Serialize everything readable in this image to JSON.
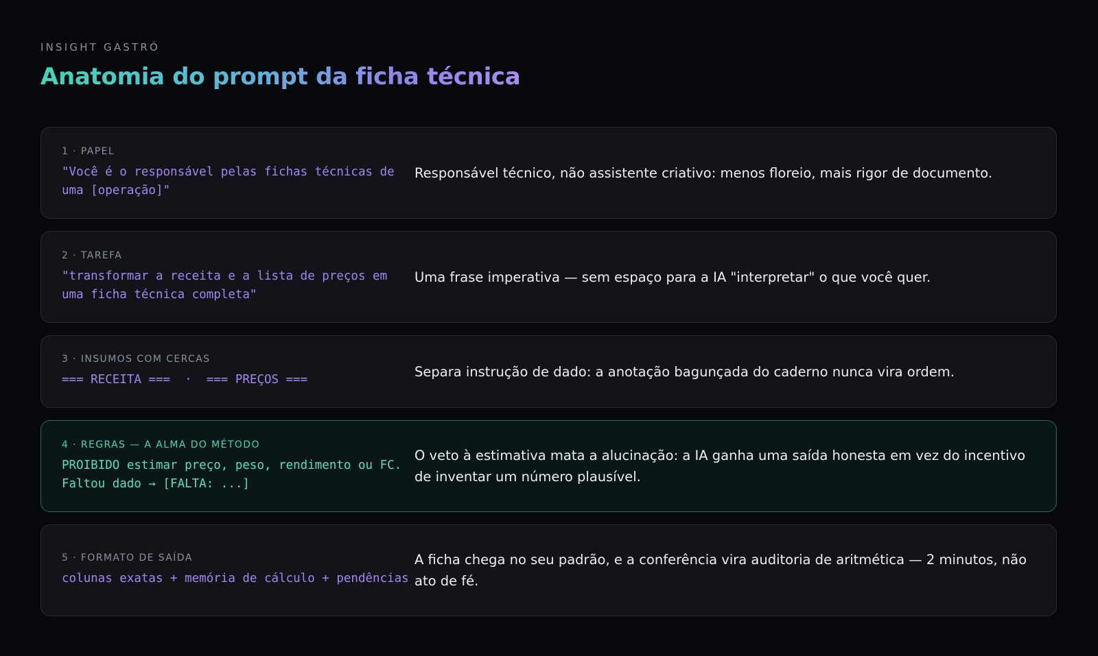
{
  "header": {
    "eyebrow": "INSIGHT GASTRÓ",
    "title": "Anatomia do prompt da ficha técnica"
  },
  "cards": [
    {
      "label": "1 · PAPEL",
      "code": "\"Você é o responsável pelas fichas técnicas de uma [operação]\"",
      "description": "Responsável técnico, não assistente criativo: menos floreio, mais rigor de documento."
    },
    {
      "label": "2 · TAREFA",
      "code": "\"transformar a receita e a lista de preços em uma ficha técnica completa\"",
      "description": "Uma frase imperativa — sem espaço para a IA \"interpretar\" o que você quer."
    },
    {
      "label": "3 · INSUMOS COM CERCAS",
      "code": "=== RECEITA ===  ·  === PREÇOS ===",
      "description": "Separa instrução de dado: a anotação bagunçada do caderno nunca vira ordem."
    },
    {
      "label": "4 · REGRAS — A ALMA DO MÉTODO",
      "code": "PROIBIDO estimar preço, peso, rendimento ou FC. Faltou dado → [FALTA: ...]",
      "description": "O veto à estimativa mata a alucinação: a IA ganha uma saída honesta em vez do incentivo de inventar um número plausível."
    },
    {
      "label": "5 · FORMATO DE SAÍDA",
      "code": "colunas exatas + memória de cálculo + pendências",
      "description": "A ficha chega no seu padrão, e a conferência vira auditoria de aritmética — 2 minutos, não ato de fé."
    }
  ],
  "colors": {
    "background": "#07080c",
    "card": "#131419",
    "card_highlight": "#0b1617",
    "accent_teal": "#3fd8b8",
    "accent_purple": "#a386ef"
  }
}
